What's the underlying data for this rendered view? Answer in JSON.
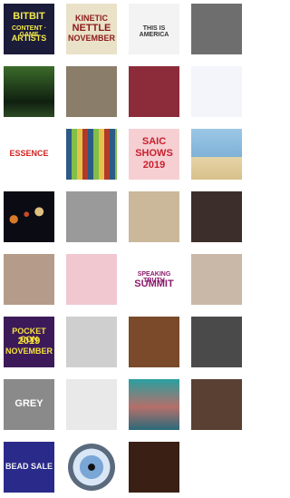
{
  "gallery": {
    "tiles": [
      {
        "name": "bitbit-poster-tile",
        "bg": "#1b1b3a",
        "lines": [
          "BITBIT",
          "CONTENT · GAME",
          "ARTISTS"
        ],
        "fg": "#f2e84a"
      },
      {
        "name": "kinetic-poster-tile",
        "bg": "#e9e1c8",
        "lines": [
          "KINETIC",
          "NETTLE",
          "NOVEMBER"
        ],
        "fg": "#8b1a1a"
      },
      {
        "name": "this-is-america-tile",
        "bg": "#f3f3f3",
        "lines": [
          "THIS IS AMERICA"
        ],
        "fg": "#333333"
      },
      {
        "name": "grey-photo-tile",
        "bg": "#6e6e6e",
        "lines": [],
        "fg": "#ffffff"
      },
      {
        "name": "forest-photo-tile",
        "bg": "#1e3b1b",
        "lines": [],
        "fg": "#ffffff"
      },
      {
        "name": "horse-rider-photo-tile",
        "bg": "#8a7d6a",
        "lines": [],
        "fg": "#ffffff"
      },
      {
        "name": "patterned-art-tile",
        "bg": "#8c2c3a",
        "lines": [],
        "fg": "#ffffff"
      },
      {
        "name": "diagram-sketch-tile",
        "bg": "#f4f4fb",
        "lines": [],
        "fg": "#5a5aa0"
      },
      {
        "name": "essence-logo-tile",
        "bg": "#ffffff",
        "lines": [
          "ESSENCE"
        ],
        "fg": "#d41f1f"
      },
      {
        "name": "stained-glass-tile",
        "bg": "#4b7a3a",
        "lines": [],
        "fg": "#ffffff"
      },
      {
        "name": "saic-shows-tile",
        "bg": "#f6cfd2",
        "lines": [
          "SAIC",
          "SHOWS",
          "2019"
        ],
        "fg": "#c8202e"
      },
      {
        "name": "beach-city-tile",
        "bg": "#7fb2d6",
        "lines": [],
        "fg": "#ffffff"
      },
      {
        "name": "planets-tile",
        "bg": "#0b0b14",
        "lines": [],
        "fg": "#ffffff"
      },
      {
        "name": "bw-group-photo-tile",
        "bg": "#9a9a9a",
        "lines": [],
        "fg": "#ffffff"
      },
      {
        "name": "portrait-board-tile",
        "bg": "#cbb89a",
        "lines": [],
        "fg": "#ffffff"
      },
      {
        "name": "two-people-tile",
        "bg": "#3c2e2a",
        "lines": [],
        "fg": "#ffffff"
      },
      {
        "name": "craft-object-tile",
        "bg": "#b59c8a",
        "lines": [],
        "fg": "#ffffff"
      },
      {
        "name": "pink-balloons-tile",
        "bg": "#f1c7d0",
        "lines": [],
        "fg": "#ffffff"
      },
      {
        "name": "speaking-truth-summit-tile",
        "bg": "#ffffff",
        "lines": [
          "SPEAKING TRUTH",
          "SUMMIT"
        ],
        "fg": "#8a1c6a"
      },
      {
        "name": "white-sculpture-tile",
        "bg": "#c9b8a8",
        "lines": [],
        "fg": "#ffffff"
      },
      {
        "name": "pocket-con-tile",
        "bg": "#3c1a5a",
        "lines": [
          "POCKET CON",
          "2019",
          "NOVEMBER"
        ],
        "fg": "#f5e23a"
      },
      {
        "name": "sketch-drawing-tile",
        "bg": "#cfcfcf",
        "lines": [],
        "fg": "#333333"
      },
      {
        "name": "abstract-painting-tile",
        "bg": "#7a4a2a",
        "lines": [],
        "fg": "#ffffff"
      },
      {
        "name": "child-photo-tile",
        "bg": "#4a4a4a",
        "lines": [],
        "fg": "#ffffff"
      },
      {
        "name": "bw-building-tile",
        "bg": "#8a8a8a",
        "lines": [
          "GREY"
        ],
        "fg": "#ffffff"
      },
      {
        "name": "screen-capture-tile",
        "bg": "#e9e9e9",
        "lines": [],
        "fg": "#333333"
      },
      {
        "name": "woman-portrait-tile",
        "bg": "#4fa7a2",
        "lines": [],
        "fg": "#ffffff"
      },
      {
        "name": "studio-interior-tile",
        "bg": "#5a4032",
        "lines": [],
        "fg": "#ffffff"
      },
      {
        "name": "bead-sale-tile",
        "bg": "#2a2a8a",
        "lines": [
          "BEAD SALE"
        ],
        "fg": "#f2f2f2"
      },
      {
        "name": "eye-circle-tile",
        "bg": "#ffffff",
        "lines": [],
        "fg": "#ffffff"
      },
      {
        "name": "dark-figure-tile",
        "bg": "#3a1f14",
        "lines": [],
        "fg": "#ffffff"
      }
    ]
  }
}
